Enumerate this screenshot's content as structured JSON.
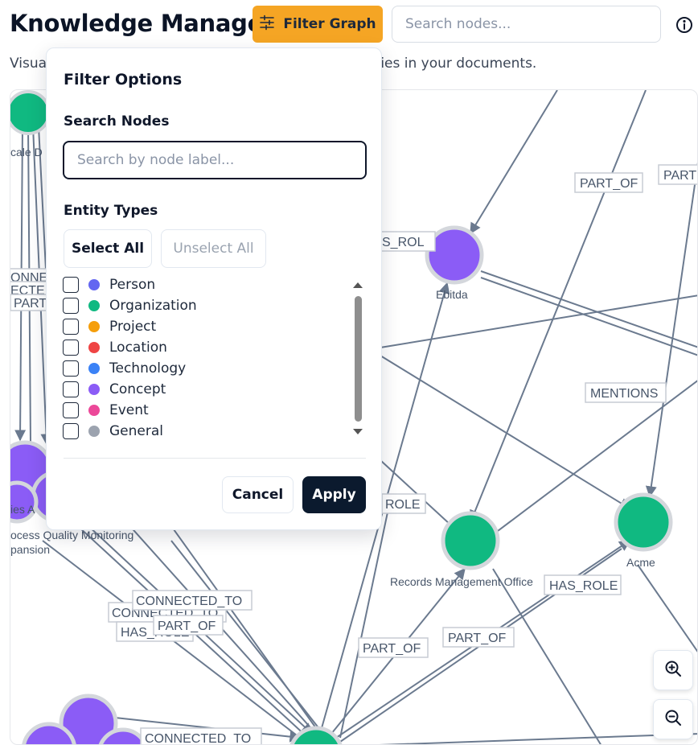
{
  "header": {
    "title": "Knowledge Manager",
    "filter_button_label": "Filter Graph",
    "search_placeholder": "Search nodes...",
    "subtitle_left": "Visua",
    "subtitle_right": "entities in your documents."
  },
  "filter_panel": {
    "title": "Filter Options",
    "search_label": "Search Nodes",
    "search_placeholder": "Search by node label...",
    "entity_types_label": "Entity Types",
    "select_all_label": "Select All",
    "unselect_all_label": "Unselect All",
    "entity_types": [
      {
        "label": "Person",
        "color": "#6366f1",
        "checked": false
      },
      {
        "label": "Organization",
        "color": "#10b981",
        "checked": false
      },
      {
        "label": "Project",
        "color": "#f59e0b",
        "checked": false
      },
      {
        "label": "Location",
        "color": "#ef4444",
        "checked": false
      },
      {
        "label": "Technology",
        "color": "#3b82f6",
        "checked": false
      },
      {
        "label": "Concept",
        "color": "#8b5cf6",
        "checked": false
      },
      {
        "label": "Event",
        "color": "#ec4899",
        "checked": false
      },
      {
        "label": "General",
        "color": "#9ca3af",
        "checked": false
      }
    ],
    "cancel_label": "Cancel",
    "apply_label": "Apply"
  },
  "graph": {
    "node_labels": {
      "ebitda": "Ebitda",
      "records": "Records Management Office",
      "acme": "Acme",
      "process": "ocess Quality Monitoring",
      "expansion": "pansion",
      "partial_left": "ies A",
      "partial_top": "cale D"
    },
    "edge_labels": {
      "part_of_1": "PART_OF",
      "part_1": "PART",
      "has_role_top": "S_ROL",
      "mentions": "MENTIONS",
      "role_mid": "ROLE",
      "has_role_right": "HAS_ROLE",
      "connected_to_1": "CONNECTED_TO",
      "connected_to_2": "CONNECTED_TO",
      "part_of_2": "PART_OF",
      "has_role_2": "HAS_ROLE",
      "part_of_3": "PART_OF",
      "part_of_4": "PART_OF",
      "connected_to_3": "CONNECTED_TO",
      "left_1": "ONNE",
      "left_2": "ECTE",
      "left_3": "PART",
      "left_4": "P"
    },
    "colors": {
      "organization": "#10b981",
      "concept": "#8b5cf6",
      "edge": "#6b7a8f",
      "node_ring": "#d4d7dc"
    }
  },
  "zoom": {
    "zoom_in_icon": "zoom-in-icon",
    "zoom_out_icon": "zoom-out-icon"
  }
}
